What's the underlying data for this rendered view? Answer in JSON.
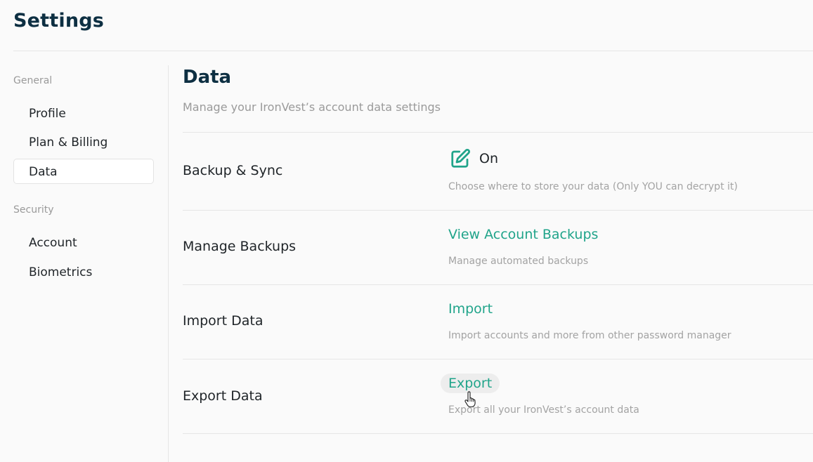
{
  "page": {
    "title": "Settings"
  },
  "sidebar": {
    "sections": [
      {
        "label": "General",
        "items": [
          {
            "label": "Profile",
            "active": false
          },
          {
            "label": "Plan & Billing",
            "active": false
          },
          {
            "label": "Data",
            "active": true
          }
        ]
      },
      {
        "label": "Security",
        "items": [
          {
            "label": "Account",
            "active": false
          },
          {
            "label": "Biometrics",
            "active": false
          }
        ]
      }
    ]
  },
  "main": {
    "title": "Data",
    "subtitle": "Manage your IronVest’s account data settings",
    "rows": [
      {
        "label": "Backup & Sync",
        "value": "On",
        "icon": "edit-icon",
        "description": "Choose where to store your data (Only YOU can decrypt it)"
      },
      {
        "label": "Manage Backups",
        "action": "View Account Backups",
        "description": "Manage automated backups"
      },
      {
        "label": "Import Data",
        "action": "Import",
        "description": "Import accounts and more from other password manager"
      },
      {
        "label": "Export Data",
        "action": "Export",
        "description": "Export all your IronVest’s account data"
      }
    ]
  },
  "colors": {
    "accent": "#20a48a",
    "title": "#0d2f42",
    "muted": "#9a9a9a",
    "divider": "#e6e6e6",
    "background": "#fafafa"
  }
}
